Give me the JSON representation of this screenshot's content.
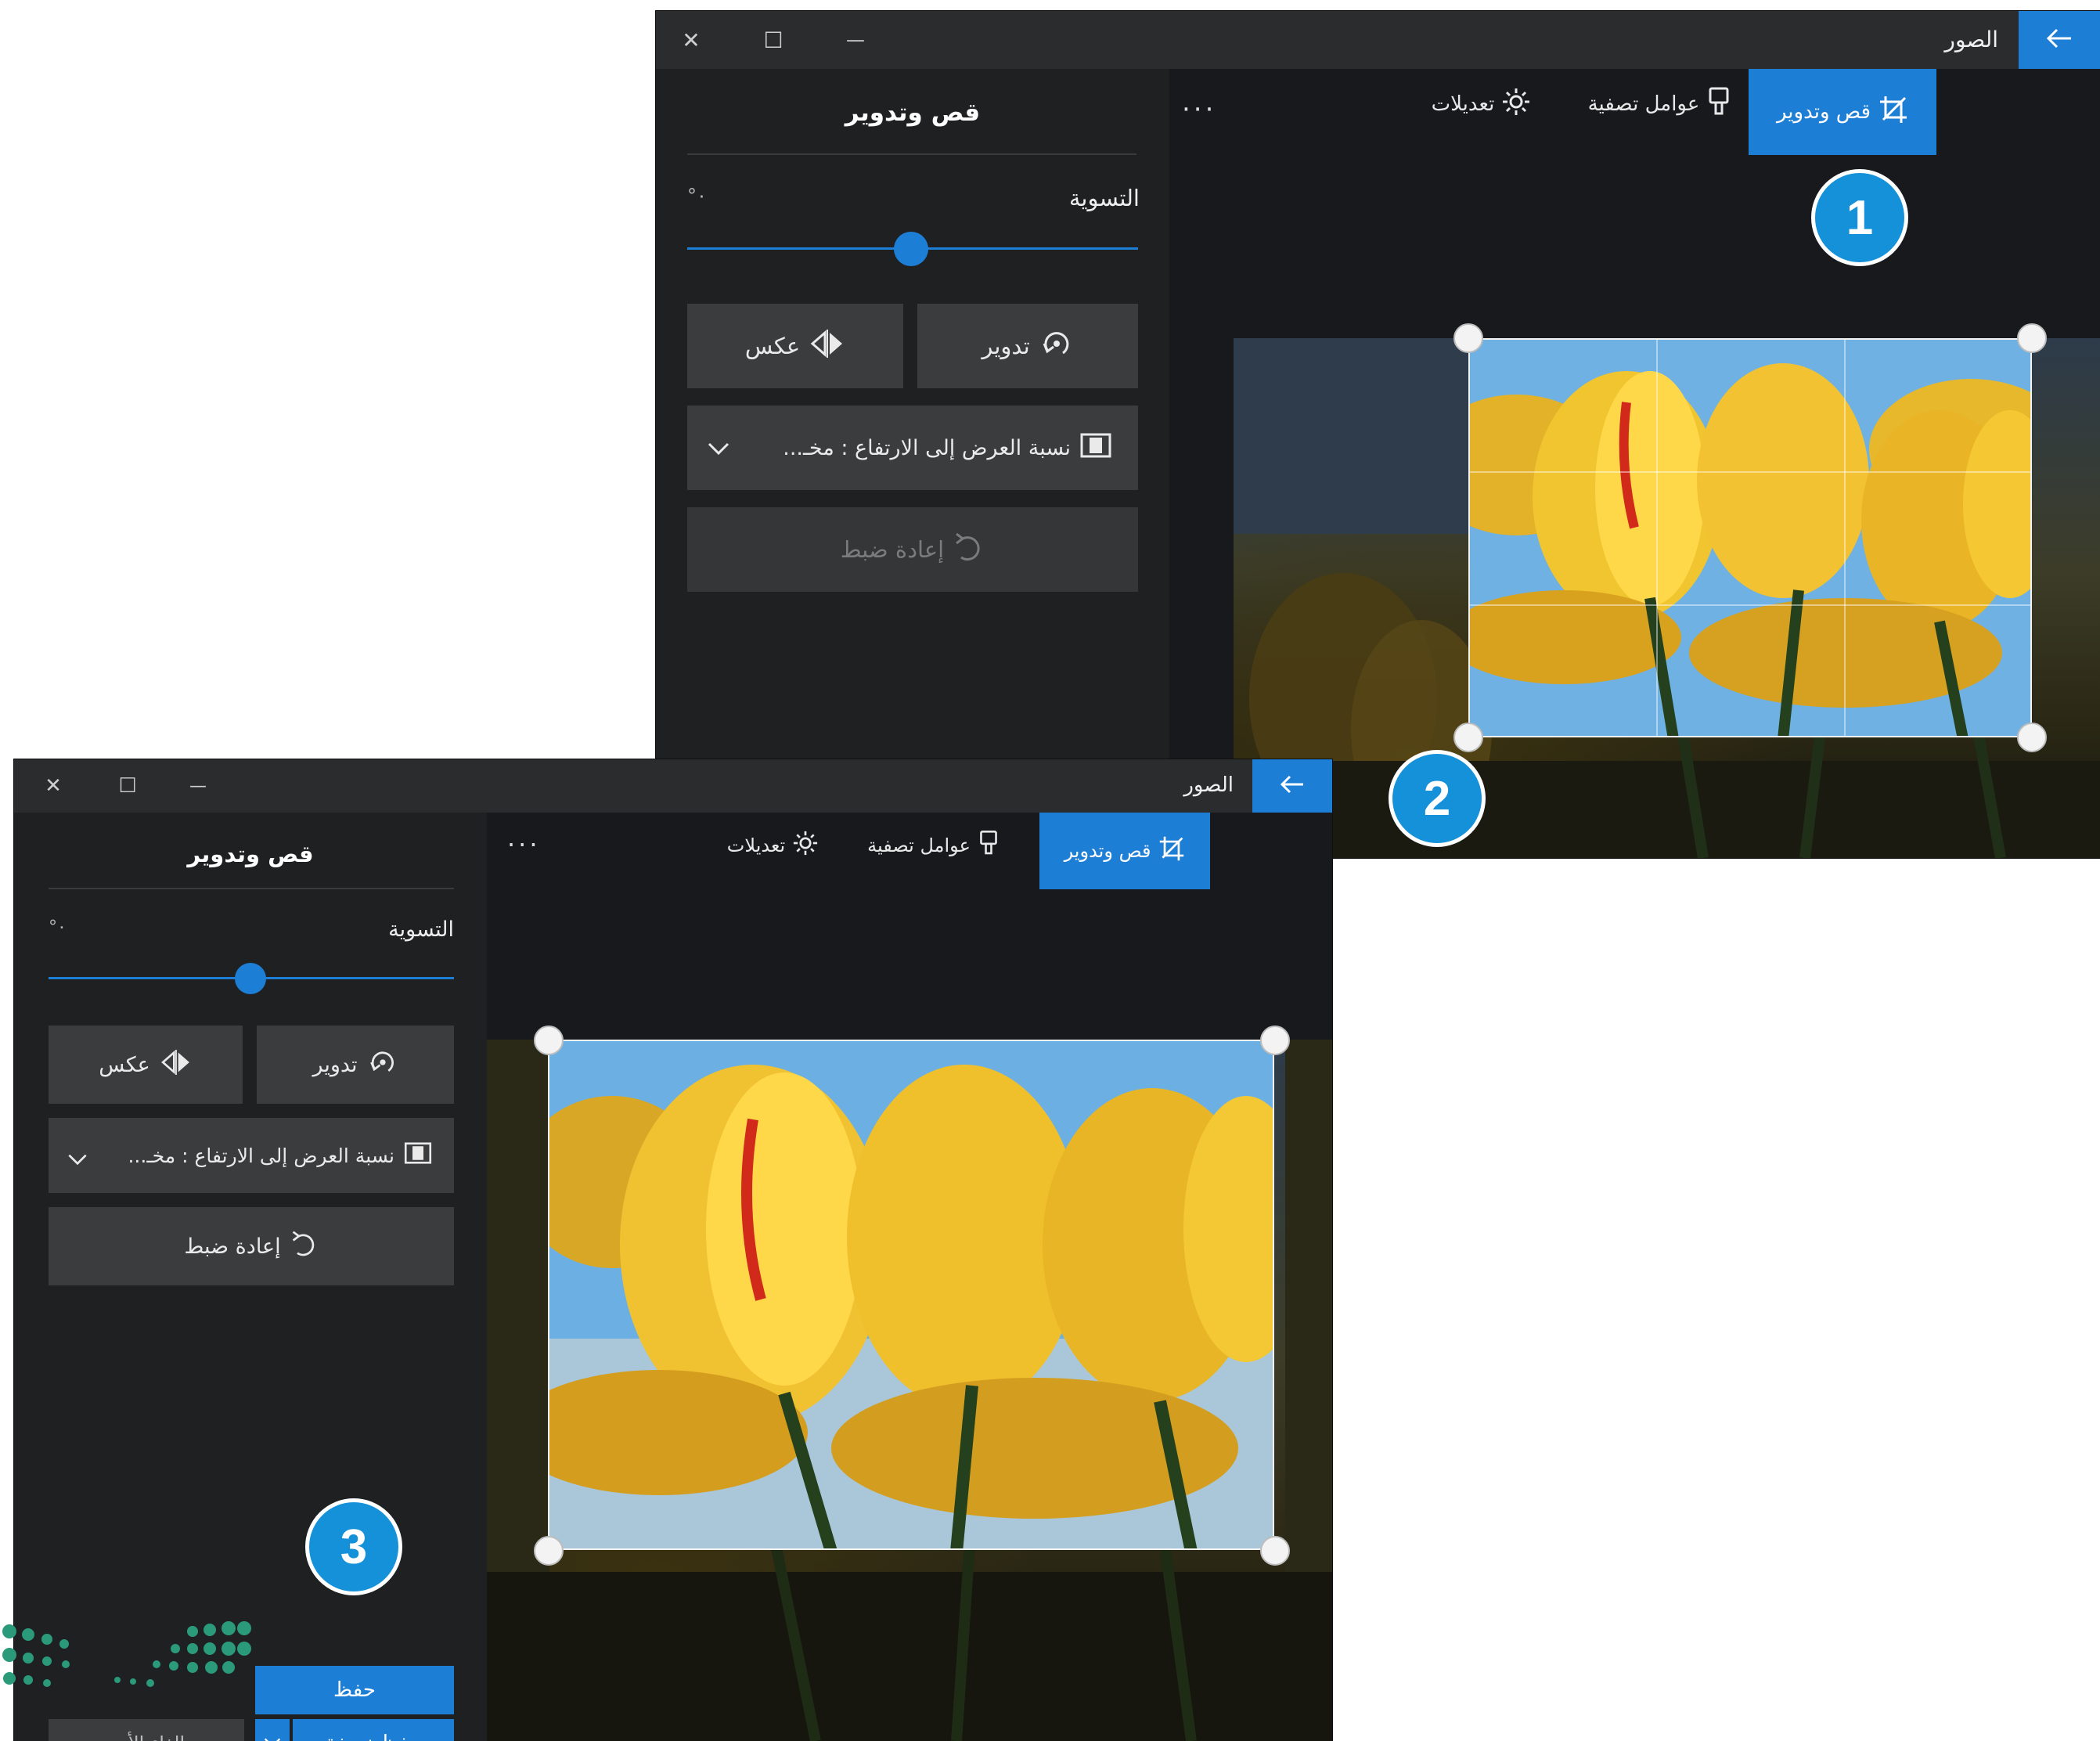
{
  "windows": [
    {
      "id": "top",
      "app_title": "الصور",
      "title_buttons": [
        "✕",
        "☐",
        "—"
      ],
      "toolbar": {
        "crop_label": "قص وتدوير",
        "filters_label": "عوامل تصفية",
        "adjust_label": "تعديلات",
        "more_label": "···"
      },
      "panel": {
        "title": "قص وتدوير",
        "straighten_label": "التسوية",
        "straighten_value": "°٠",
        "rotate_label": "تدوير",
        "flip_label": "عكس",
        "aspect_label": "نسبة العرض إلى الارتفاع : مخـ...",
        "reset_label": "إعادة ضبط"
      }
    },
    {
      "id": "bottom",
      "app_title": "الصور",
      "title_buttons": [
        "✕",
        "☐",
        "—"
      ],
      "toolbar": {
        "crop_label": "قص وتدوير",
        "filters_label": "عوامل تصفية",
        "adjust_label": "تعديلات",
        "more_label": "···"
      },
      "panel": {
        "title": "قص وتدوير",
        "straighten_label": "التسوية",
        "straighten_value": "°٠",
        "rotate_label": "تدوير",
        "flip_label": "عكس",
        "aspect_label": "نسبة العرض إلى الارتفاع : مخـ...",
        "reset_label": "إعادة ضبط",
        "save_label": "حفظ",
        "save_copy_label": "حفظ نسخة",
        "cancel_label": "إلغاء الأمر"
      }
    }
  ],
  "callouts": [
    "1",
    "2",
    "3"
  ],
  "icons": {
    "back": "arrow-left-icon",
    "crop": "crop-icon",
    "filters": "paint-brush-icon",
    "adjust": "sun-icon",
    "rotate": "rotate-icon",
    "flip": "flip-icon",
    "aspect": "aspect-ratio-icon",
    "reset": "undo-icon",
    "dropdown": "chevron-down-icon"
  },
  "colors": {
    "accent": "#1d7ed6",
    "callout": "#1591da",
    "window_bg": "#1f2022",
    "titlebar_bg": "#2b2c2e"
  }
}
